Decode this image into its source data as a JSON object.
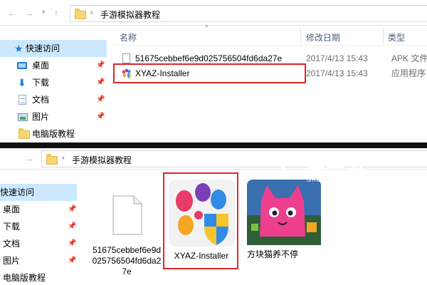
{
  "top_window": {
    "nav": {
      "back": "←",
      "forward": "→",
      "dropdown": "▾",
      "up": "↑"
    },
    "breadcrumb": {
      "separator": "›",
      "path": "手游模拟器教程"
    },
    "sidebar": [
      {
        "label": "快速访问",
        "icon": "star-icon",
        "selected": true
      },
      {
        "label": "桌面",
        "icon": "desktop-icon",
        "pinned": true
      },
      {
        "label": "下载",
        "icon": "download-icon",
        "pinned": true
      },
      {
        "label": "文档",
        "icon": "document-icon",
        "pinned": true
      },
      {
        "label": "图片",
        "icon": "picture-icon",
        "pinned": true
      },
      {
        "label": "电脑版教程",
        "icon": "folder-icon"
      }
    ],
    "pin_glyph": "📌",
    "columns": {
      "name": "名称",
      "date": "修改日期",
      "type": "类型",
      "sort_indicator": "^"
    },
    "files": [
      {
        "name": "51675cebbef6e9d025756504fd6da27e",
        "date": "2017/4/13 15:43",
        "type": "APK 文件"
      },
      {
        "name": "XYAZ-Installer",
        "date": "2017/4/13 15:43",
        "type": "应用程序"
      }
    ]
  },
  "bottom_window": {
    "breadcrumb": {
      "separator": "›",
      "path": "手游模拟器教程"
    },
    "sidebar": [
      {
        "label": "快速访问",
        "selected": true
      },
      {
        "label": "桌面",
        "pinned": true
      },
      {
        "label": "下载",
        "pinned": true
      },
      {
        "label": "文档",
        "pinned": true
      },
      {
        "label": "图片",
        "pinned": true
      },
      {
        "label": "电脑版教程"
      }
    ],
    "tiles": [
      {
        "label": "51675cebbef6e9d025756504fd6da27e",
        "kind": "blank-file"
      },
      {
        "label": "XYAZ-Installer",
        "kind": "installer"
      },
      {
        "label": "方块猫养不停",
        "kind": "game-icon"
      }
    ]
  },
  "watermark": {
    "title": "高手游",
    "subtitle": "GAOSHOUYOU.COM"
  },
  "colors": {
    "highlight_red": "#e0262a",
    "selection_blue": "#cce8ff",
    "accent_blue": "#1e7fd8"
  }
}
